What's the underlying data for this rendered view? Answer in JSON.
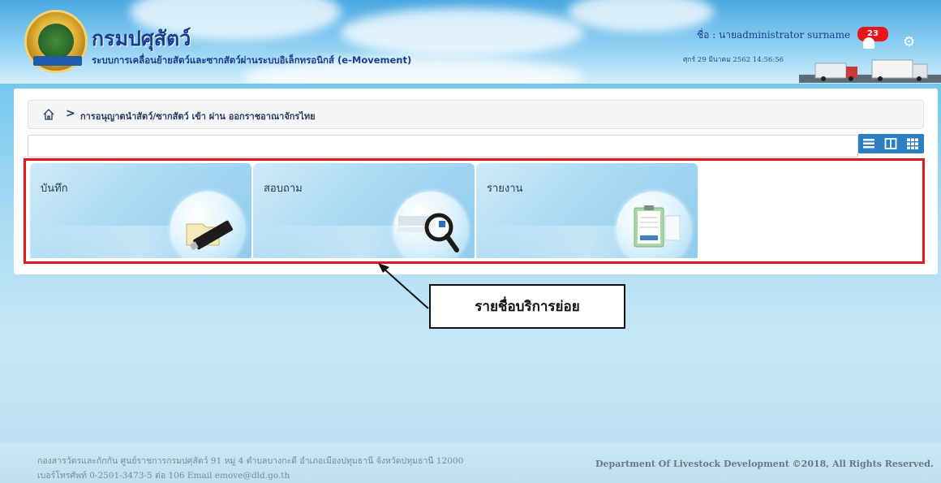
{
  "header": {
    "title": "กรมปศุสัตว์",
    "subtitle": "ระบบการเคลื่อนย้ายสัตว์และซากสัตว์ผ่านระบบอิเล็กทรอนิกส์ (e-Movement)",
    "user_name": "ชื่อ : นายadministrator surname",
    "datetime": "ศุกร์ 29 มีนาคม 2562 14:56:56",
    "notification_count": "23",
    "icons": [
      "bell-icon",
      "gear-icon"
    ]
  },
  "breadcrumb": {
    "home_icon": "home-icon",
    "separator": ">",
    "current": "การอนุญาตนำสัตว์/ซากสัตว์ เข้า ผ่าน ออกราชอาณาจักรไทย"
  },
  "view_toggles": [
    "list-view-icon",
    "two-column-view-icon",
    "grid-view-icon"
  ],
  "tiles": [
    {
      "label": "บันทึก",
      "icon": "usb-drive-icon"
    },
    {
      "label": "สอบถาม",
      "icon": "magnifier-icon"
    },
    {
      "label": "รายงาน",
      "icon": "report-clipboard-icon"
    }
  ],
  "annotation": {
    "callout_text": "รายชื่อบริการย่อย",
    "highlight_color": "#e3141b"
  },
  "footer": {
    "address_line1": "กองสารวัตรและกักกัน ศูนย์ราชการกรมปศุสัตว์ 91 หมู่ 4 ตำบลบางกะดี อำเภอเมืองปทุมธานี จังหวัดปทุมธานี 12000",
    "address_line2": "เบอร์โทรศัพท์ 0-2501-3473-5 ต่อ 106 Email emove@dld.go.th",
    "copyright": "Department Of Livestock Development ©2018, All Rights Reserved."
  }
}
